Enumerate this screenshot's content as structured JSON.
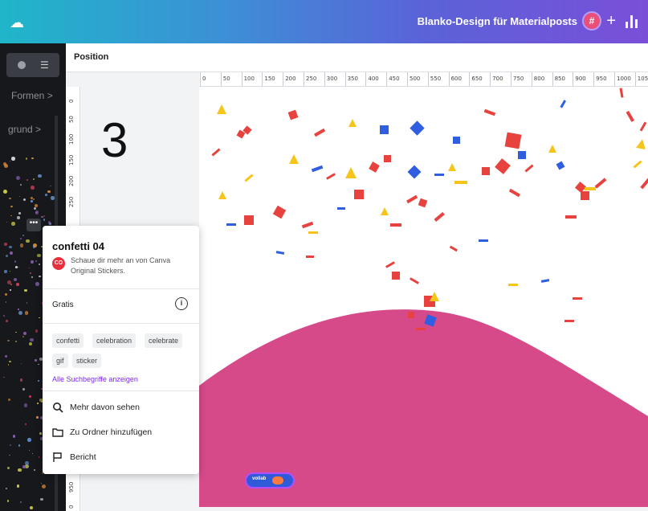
{
  "topbar": {
    "title": "Blanko-Design für Materialposts",
    "avatar_label": "#",
    "plus_label": "+"
  },
  "sidepanel": {
    "cat1": "Formen",
    "cat2": "grund",
    "chevron": ">"
  },
  "propbar": {
    "position_label": "Position"
  },
  "ruler_top": [
    "0",
    "50",
    "100",
    "150",
    "200",
    "250",
    "300",
    "350",
    "400",
    "450",
    "500",
    "550",
    "600",
    "650",
    "700",
    "750",
    "800",
    "850",
    "900",
    "950",
    "1000",
    "105"
  ],
  "ruler_left": [
    "0",
    "50",
    "100",
    "150",
    "200",
    "250",
    "950",
    "0"
  ],
  "step_number": "3",
  "dots_label": "•••",
  "popup": {
    "title": "confetti 04",
    "author_initials": "CO",
    "description": "Schaue dir mehr an von Canva Original Stickers.",
    "price": "Gratis",
    "info": "i",
    "tags": [
      "confetti",
      "celebration",
      "celebrate",
      "gif",
      "sticker"
    ],
    "show_all": "Alle Suchbegriffe anzeigen",
    "actions": [
      "Mehr davon sehen",
      "Zu Ordner hinzufügen",
      "Bericht"
    ]
  },
  "watermark": {
    "label": "vollab"
  },
  "colors": {
    "confetti_red": "#e8423f",
    "confetti_blue": "#2f5fe0",
    "confetti_yellow": "#f5c51c",
    "hill_pink": "#d64a8a",
    "accent_purple": "#7d2ae8"
  }
}
